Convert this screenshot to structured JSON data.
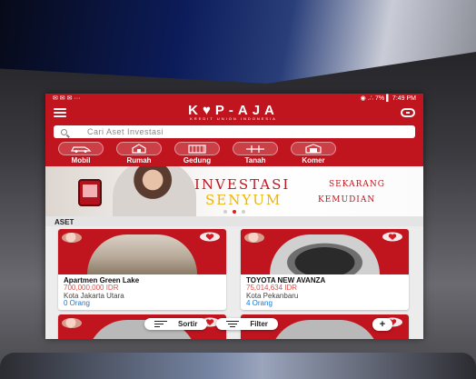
{
  "status_bar": {
    "left_icons": "✉ ✉ ✉ ···",
    "right": "◉ .∴ 7% ▌ 7:49 PM"
  },
  "app": {
    "name": "K♥P-AJA",
    "subtitle": "KREDIT UNION INDONESIA"
  },
  "search": {
    "placeholder": "Cari Aset Investasi"
  },
  "categories": [
    {
      "label": "Mobil",
      "icon": "car-icon"
    },
    {
      "label": "Rumah",
      "icon": "house-icon"
    },
    {
      "label": "Gedung",
      "icon": "building-icon"
    },
    {
      "label": "Tanah",
      "icon": "land-icon"
    },
    {
      "label": "Komer",
      "icon": "shop-icon"
    }
  ],
  "banner": {
    "line1": "INVESTASI",
    "line1_small": "SEKARANG",
    "line2": "SENYUM",
    "line2_small": "KEMUDIAN",
    "active_slide": 2,
    "slides": 3
  },
  "section_title": "ASET",
  "listings": [
    {
      "name": "Apartmen Green Lake",
      "price": "700,000,000 IDR",
      "location": "Kota Jakarta Utara",
      "count": "0 Orang"
    },
    {
      "name": "TOYOTA NEW AVANZA",
      "price": "75,014,634 IDR",
      "location": "Kota Pekanbaru",
      "count": "4 Orang"
    }
  ],
  "actions": {
    "sort_label": "Sortir",
    "filter_label": "Filter",
    "add_label": "+"
  },
  "colors": {
    "primary": "#c0151f",
    "price": "#d9534f",
    "count": "#1976d2",
    "banner_gold": "#f0b400"
  }
}
